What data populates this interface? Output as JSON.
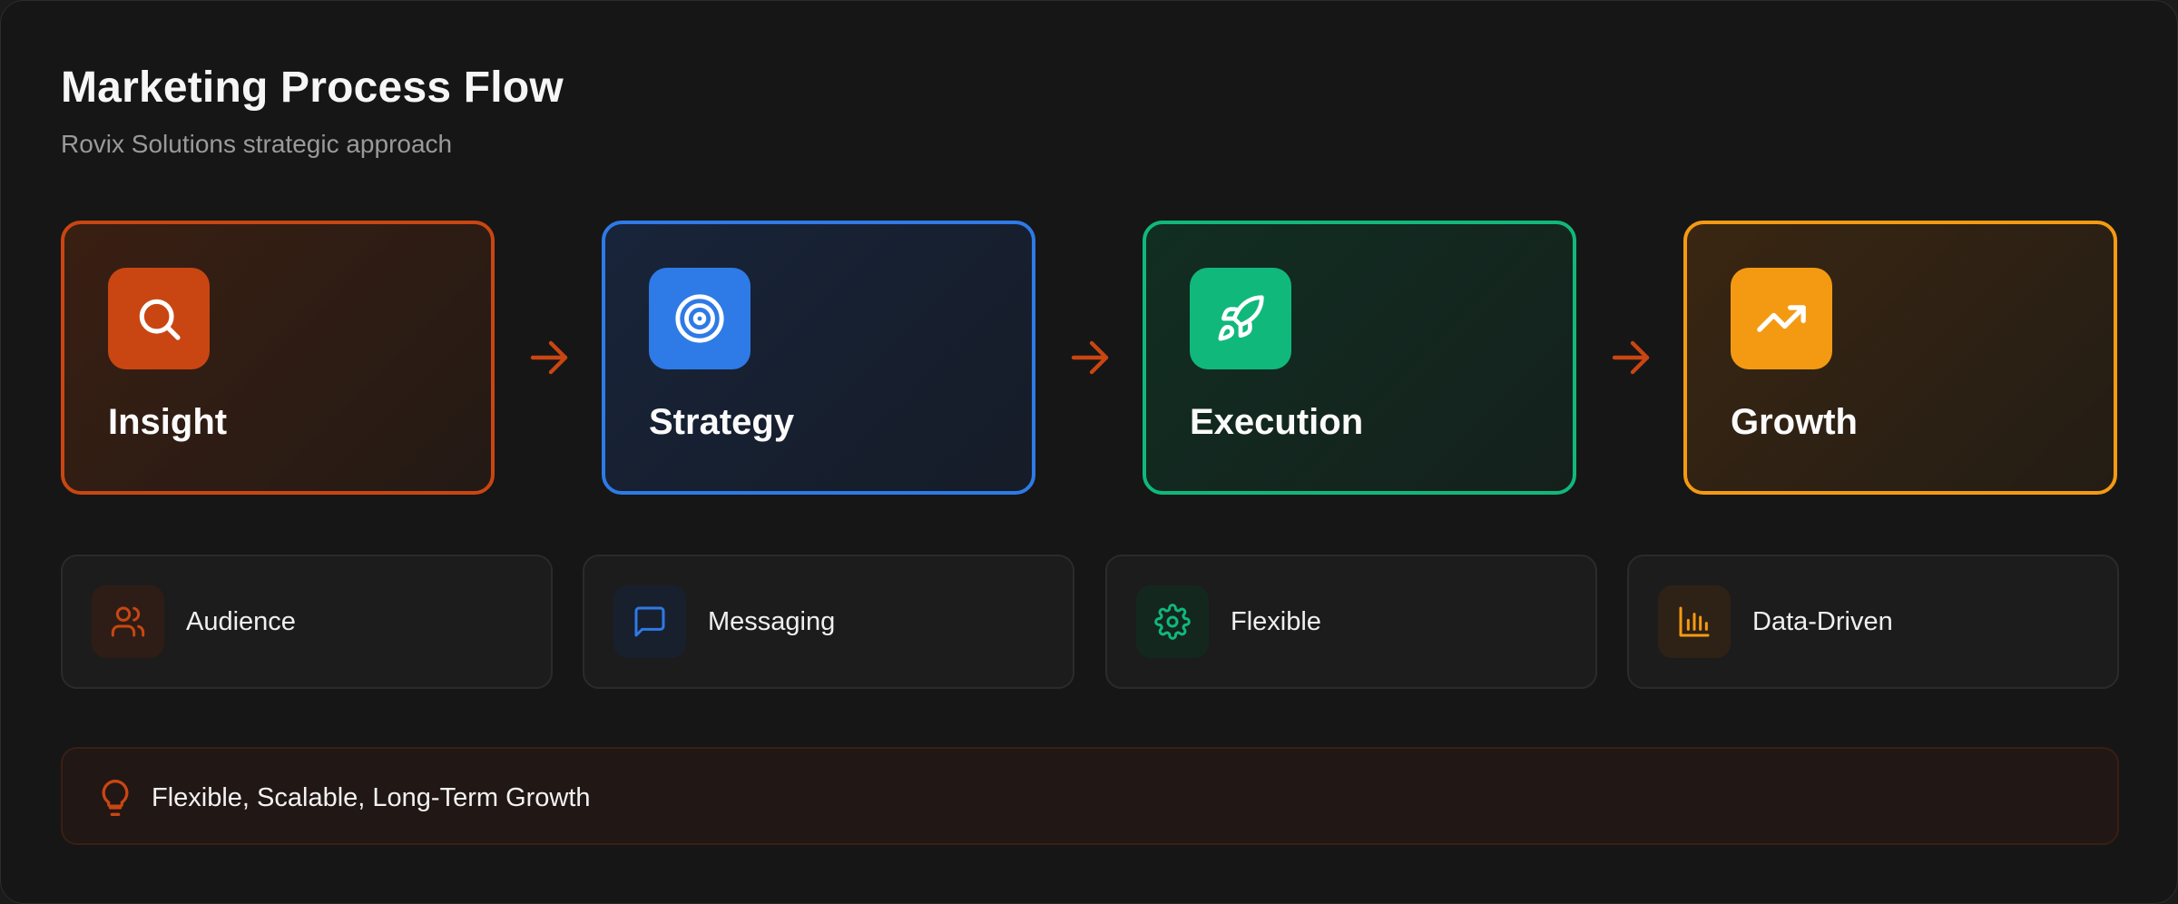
{
  "header": {
    "title": "Marketing Process Flow",
    "subtitle": "Rovix Solutions strategic approach"
  },
  "steps": [
    {
      "label": "Insight",
      "icon": "search-icon",
      "color": "#c94612"
    },
    {
      "label": "Strategy",
      "icon": "target-icon",
      "color": "#2e7ae6"
    },
    {
      "label": "Execution",
      "icon": "rocket-icon",
      "color": "#10b87c"
    },
    {
      "label": "Growth",
      "icon": "trending-up-icon",
      "color": "#f49a12"
    }
  ],
  "connector": {
    "icon": "arrow-right-icon",
    "color": "#c94612"
  },
  "features": [
    {
      "label": "Audience",
      "icon": "users-icon",
      "color": "#c94612"
    },
    {
      "label": "Messaging",
      "icon": "message-square-icon",
      "color": "#2e7ae6"
    },
    {
      "label": "Flexible",
      "icon": "gear-icon",
      "color": "#10b87c"
    },
    {
      "label": "Data-Driven",
      "icon": "bar-chart-icon",
      "color": "#f49a12"
    }
  ],
  "banner": {
    "text": "Flexible, Scalable, Long-Term Growth",
    "icon": "lightbulb-icon",
    "color": "#c94612"
  }
}
